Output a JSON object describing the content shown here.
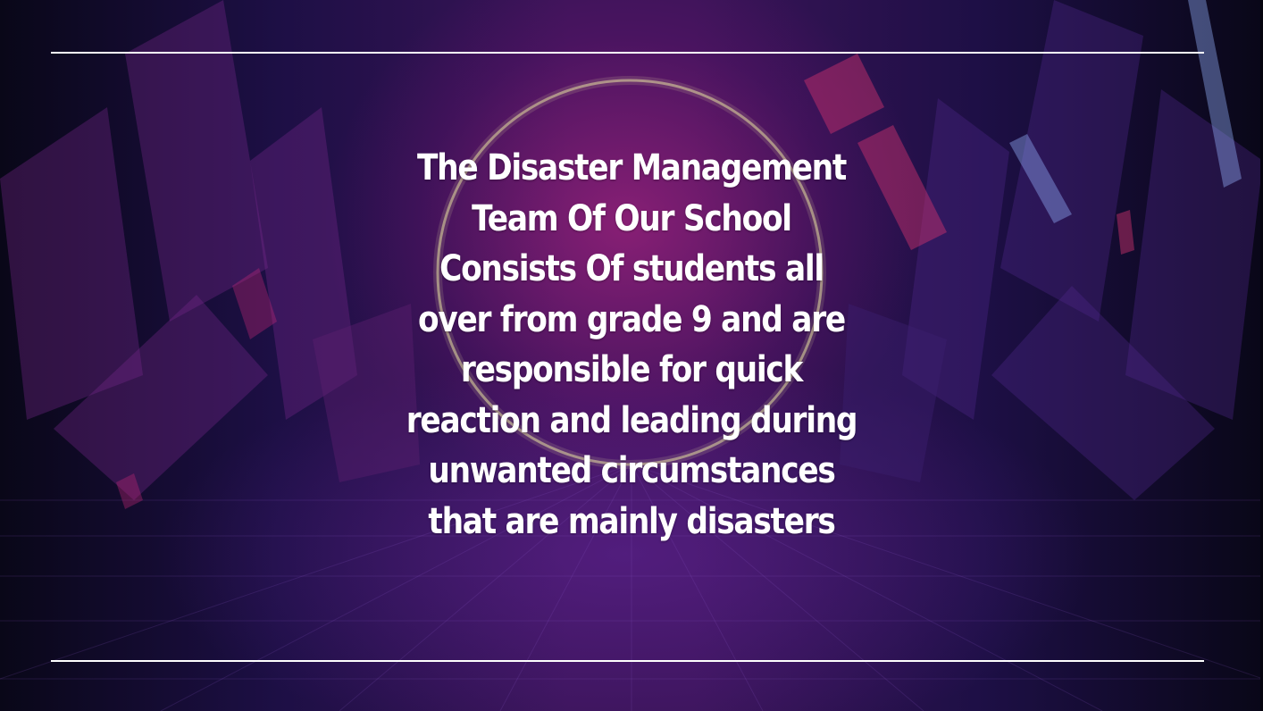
{
  "slide": {
    "body_text": "The Disaster Management Team Of Our School Consists Of students all over from grade 9 and are responsible for quick reaction and leading during unwanted circumstances that are mainly disasters",
    "colors": {
      "text": "#ffffff",
      "rule": "#ffffff",
      "background_dark": "#0b0620",
      "background_accent": "#c8288c",
      "ring": "#e6e0a0"
    },
    "background_image": "neon-ring-corridor"
  }
}
